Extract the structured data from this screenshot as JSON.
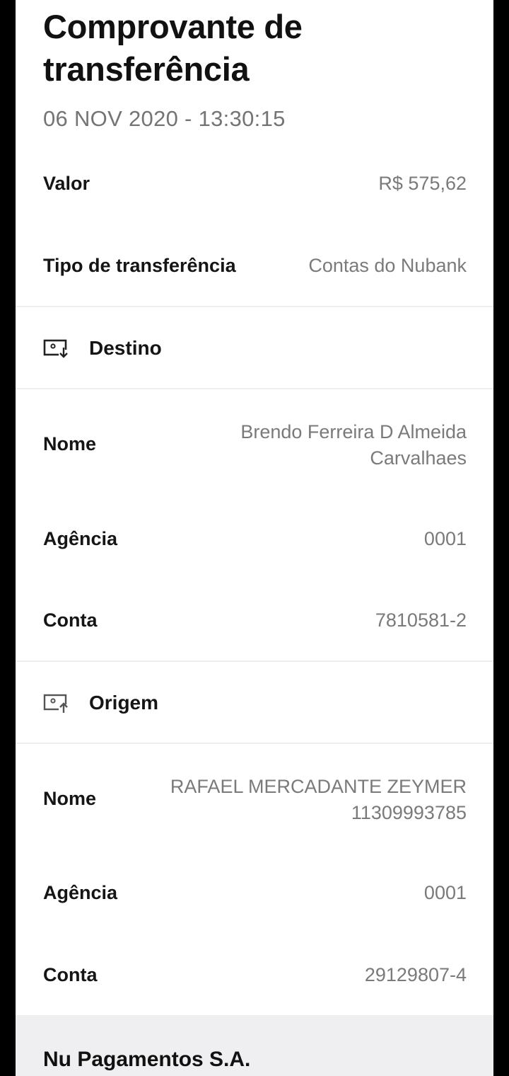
{
  "header": {
    "title": "Comprovante de transferência",
    "datetime": "06 NOV 2020 - 13:30:15"
  },
  "summary": {
    "valor_label": "Valor",
    "valor_value": "R$ 575,62",
    "tipo_label": "Tipo de transferência",
    "tipo_value": "Contas do Nubank"
  },
  "destino": {
    "title": "Destino",
    "icon": "screen-download-icon",
    "nome_label": "Nome",
    "nome_line1": "Brendo Ferreira D Almeida",
    "nome_line2": "Carvalhaes",
    "agencia_label": "Agência",
    "agencia_value": "0001",
    "conta_label": "Conta",
    "conta_value": "7810581-2"
  },
  "origem": {
    "title": "Origem",
    "icon": "screen-upload-icon",
    "nome_label": "Nome",
    "nome_line1": "RAFAEL MERCADANTE ZEYMER",
    "nome_line2": "11309993785",
    "agencia_label": "Agência",
    "agencia_value": "0001",
    "conta_label": "Conta",
    "conta_value": "29129807-4"
  },
  "footer": {
    "institution": "Nu Pagamentos S.A."
  },
  "colors": {
    "background": "#000000",
    "card": "#ffffff",
    "muted_text": "#7a7a7a",
    "footer_bg": "#efeff1"
  }
}
